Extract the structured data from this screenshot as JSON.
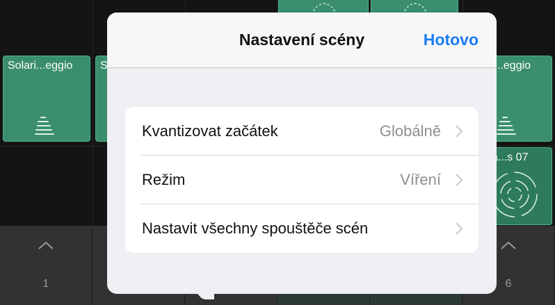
{
  "background": {
    "clips": [
      {
        "label": "Solari...eggio"
      },
      {
        "label": "S"
      },
      {
        "label": "i...eggio"
      },
      {
        "label": "a...s 07"
      }
    ],
    "triggers": [
      {
        "number": "1"
      },
      {
        "number": "6"
      }
    ]
  },
  "popover": {
    "title": "Nastavení scény",
    "done_label": "Hotovo",
    "rows": [
      {
        "label": "Kvantizovat začátek",
        "value": "Globálně"
      },
      {
        "label": "Režim",
        "value": "Víření"
      },
      {
        "label": "Nastavit všechny spouštěče scén",
        "value": ""
      }
    ]
  },
  "colors": {
    "accent": "#1a7cf5",
    "clip_green": "#3a8e6d",
    "popover_bg": "#efeff4"
  }
}
